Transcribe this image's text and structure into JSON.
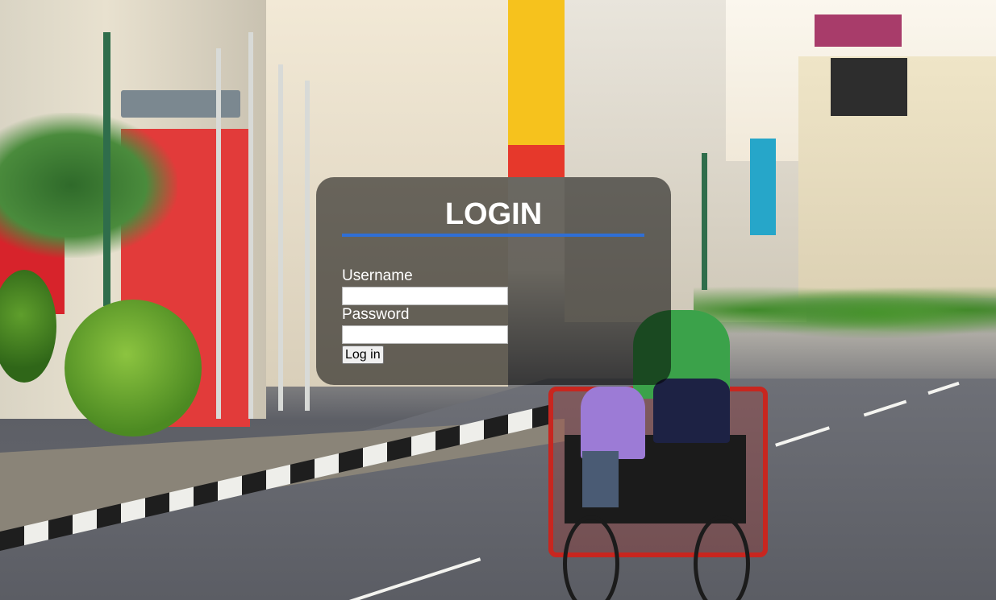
{
  "login": {
    "title": "LOGIN",
    "username_label": "Username",
    "username_value": "",
    "password_label": "Password",
    "password_value": "",
    "submit_label": "Log in"
  },
  "colors": {
    "panel_bg": "rgba(0,0,0,0.55)",
    "accent_rule": "#2f6fd6",
    "text": "#ffffff"
  }
}
